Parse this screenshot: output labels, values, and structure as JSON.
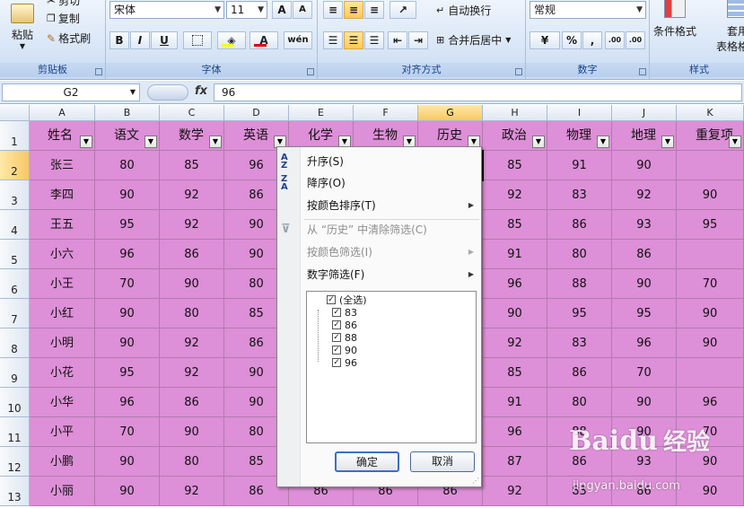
{
  "ribbon": {
    "clipboard": {
      "paste": "粘贴",
      "cut": "剪切",
      "copy": "复制",
      "format_painter": "格式刷",
      "label": "剪贴板"
    },
    "font": {
      "name": "宋体",
      "size": "11",
      "bold": "B",
      "italic": "I",
      "underline": "U",
      "grow": "A",
      "shrink": "A",
      "label": "字体",
      "phonetic": "wén"
    },
    "align": {
      "wrap": "自动换行",
      "merge": "合并后居中",
      "label": "对齐方式"
    },
    "number": {
      "format": "常规",
      "percent": "%",
      "comma": ",",
      "inc_dec": ".00",
      "dec_dec": ".00",
      "label": "数字"
    },
    "styles": {
      "cond": "条件格式",
      "table": "套用",
      "table2": "表格格式",
      "label": "样式"
    }
  },
  "formula_bar": {
    "name_box": "G2",
    "fx": "fx",
    "value": "96"
  },
  "columns": [
    "A",
    "B",
    "C",
    "D",
    "E",
    "F",
    "G",
    "H",
    "I",
    "J",
    "K"
  ],
  "rows": [
    "1",
    "2",
    "3",
    "4",
    "5",
    "6",
    "7",
    "8",
    "9",
    "10",
    "11",
    "12",
    "13"
  ],
  "header_row": [
    "姓名",
    "语文",
    "数学",
    "英语",
    "化学",
    "生物",
    "历史",
    "政治",
    "物理",
    "地理",
    "重复项"
  ],
  "data": [
    [
      "张三",
      "80",
      "85",
      "96",
      "",
      "",
      "",
      "85",
      "91",
      "90",
      ""
    ],
    [
      "李四",
      "90",
      "92",
      "86",
      "",
      "",
      "",
      "92",
      "83",
      "92",
      "90"
    ],
    [
      "王五",
      "95",
      "92",
      "90",
      "",
      "",
      "",
      "85",
      "86",
      "93",
      "95"
    ],
    [
      "小六",
      "96",
      "86",
      "90",
      "",
      "",
      "",
      "91",
      "80",
      "86",
      ""
    ],
    [
      "小王",
      "70",
      "90",
      "80",
      "",
      "",
      "",
      "96",
      "88",
      "90",
      "70"
    ],
    [
      "小红",
      "90",
      "80",
      "85",
      "",
      "",
      "",
      "90",
      "95",
      "95",
      "90"
    ],
    [
      "小明",
      "90",
      "92",
      "86",
      "",
      "",
      "",
      "92",
      "83",
      "96",
      "90"
    ],
    [
      "小花",
      "95",
      "92",
      "90",
      "",
      "",
      "",
      "85",
      "86",
      "70",
      ""
    ],
    [
      "小华",
      "96",
      "86",
      "90",
      "",
      "",
      "",
      "91",
      "80",
      "90",
      "96"
    ],
    [
      "小平",
      "70",
      "90",
      "80",
      "",
      "",
      "",
      "96",
      "88",
      "90",
      "70"
    ],
    [
      "小鹏",
      "90",
      "80",
      "85",
      "",
      "",
      "",
      "87",
      "86",
      "93",
      "90"
    ],
    [
      "小丽",
      "90",
      "92",
      "86",
      "86",
      "86",
      "86",
      "92",
      "83",
      "86",
      "90"
    ]
  ],
  "menu": {
    "sort_asc": "升序(S)",
    "sort_desc": "降序(O)",
    "sort_color": "按颜色排序(T)",
    "clear_filter": "从 “历史” 中清除筛选(C)",
    "filter_color": "按颜色筛选(I)",
    "number_filter": "数字筛选(F)",
    "checklist": [
      "(全选)",
      "83",
      "86",
      "88",
      "90",
      "96"
    ],
    "ok": "确定",
    "cancel": "取消"
  },
  "watermark": {
    "brand": "Baidu",
    "brand2": "经验",
    "url": "jingyan.baidu.com"
  },
  "colors": {
    "cell_fill": "#dd8fd7",
    "ribbon": "#d9e6f7",
    "selection": "#f7c864"
  }
}
